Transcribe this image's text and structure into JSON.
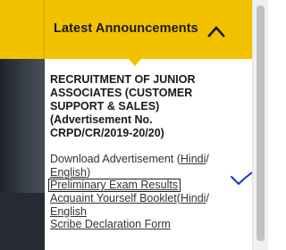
{
  "header": {
    "title": "Latest Announcements",
    "collapse_icon": "chevron-up-icon",
    "color": "#f2c200"
  },
  "announcement": {
    "title": "RECRUITMENT OF JUNIOR ASSOCIATES (CUSTOMER SUPPORT & SALES) (Advertisement No. CRPD/CR/2019-20/20)",
    "download_text": "Download Advertisement (",
    "download_hindi": "Hindi",
    "download_sep": "/",
    "download_english": "English",
    "download_close": ")",
    "prelim_results": "Preliminary Exam Results",
    "acquaint_text": "Acquaint Yourself Booklet",
    "acquaint_open": "(",
    "acquaint_hindi": "Hindi",
    "acquaint_sep": "/",
    "acquaint_english": "English",
    "scribe": "Scribe Declaration Form"
  },
  "annotation": {
    "tick_color": "#1b2fd4"
  }
}
